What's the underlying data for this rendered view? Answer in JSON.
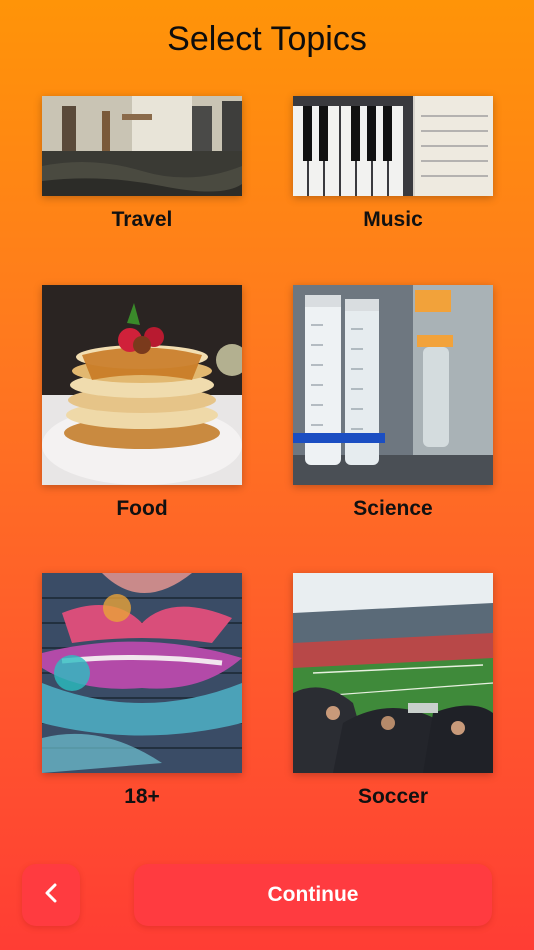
{
  "header": {
    "title": "Select Topics"
  },
  "topics": [
    {
      "label": "Travel"
    },
    {
      "label": "Music"
    },
    {
      "label": "Food"
    },
    {
      "label": "Science"
    },
    {
      "label": "18+"
    },
    {
      "label": "Soccer"
    }
  ],
  "footer": {
    "back_icon": "chevron-left-icon",
    "continue_label": "Continue"
  },
  "colors": {
    "background_top": "#ff9408",
    "background_bottom": "#ff3d34",
    "button": "#ff3b40"
  }
}
